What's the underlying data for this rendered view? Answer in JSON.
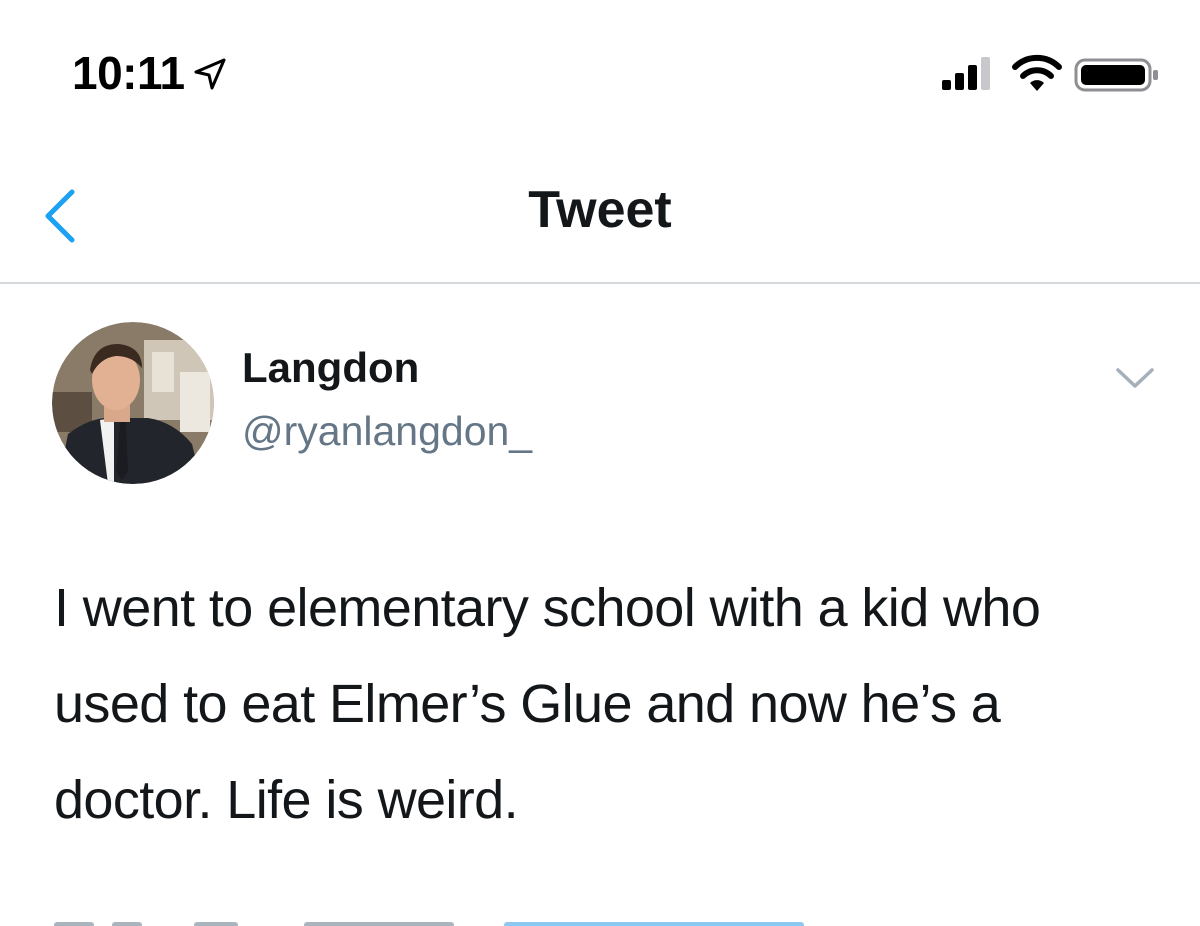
{
  "status_bar": {
    "time": "10:11",
    "location_icon": "location-arrow-icon",
    "signal_icon": "cellular-signal-icon",
    "wifi_icon": "wifi-icon",
    "battery_icon": "battery-icon"
  },
  "nav": {
    "title": "Tweet",
    "back_icon": "chevron-left-icon",
    "accent_color": "#1da1f2"
  },
  "tweet": {
    "display_name": "Langdon",
    "handle": "@ryanlangdon_",
    "avatar_icon": "profile-photo",
    "more_icon": "chevron-down-icon",
    "text": "I went to elementary school with a kid who used to eat Elmer’s Glue and now he’s a doctor. Life is weird."
  },
  "colors": {
    "text_primary": "#14171a",
    "text_secondary": "#657786",
    "divider": "#d6dadd",
    "link_blue": "#1da1f2"
  }
}
